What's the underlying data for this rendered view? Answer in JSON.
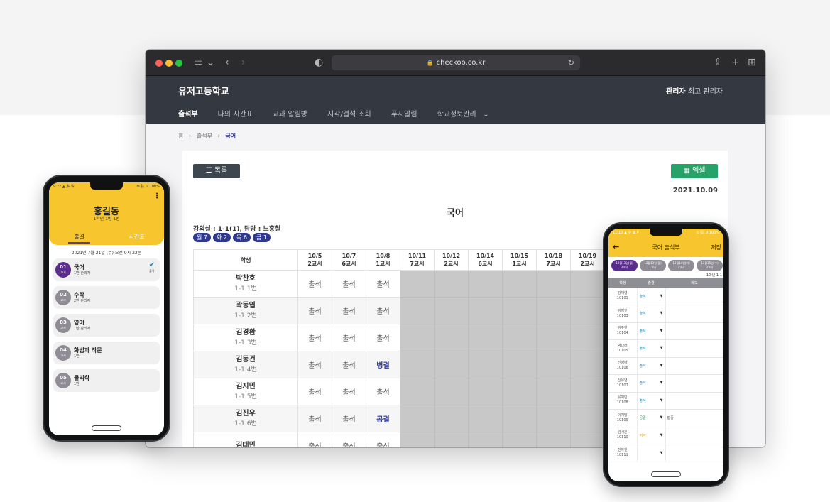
{
  "browser": {
    "url": "checkoo.co.kr"
  },
  "site": {
    "school_name": "유저고등학교",
    "admin_role": "관리자",
    "admin_name": "최고 관리자",
    "nav": [
      "출석부",
      "나의 시간표",
      "교과 알림방",
      "지각/결석 조회",
      "푸시알림",
      "학교정보관리"
    ]
  },
  "breadcrumb": [
    "홈",
    "출석부",
    "국어"
  ],
  "attendance": {
    "list_button": "목록",
    "excel_button": "엑셀",
    "date": "2021.10.09",
    "subject_title": "국어",
    "room_info": "강의실 : 1-1(1), 담당 : 노홍철",
    "day_chips": [
      "월 7",
      "화 2",
      "목 6",
      "금 1"
    ],
    "student_header": "학생",
    "columns": [
      {
        "date": "10/5",
        "period": "2교시"
      },
      {
        "date": "10/7",
        "period": "6교시"
      },
      {
        "date": "10/8",
        "period": "1교시"
      },
      {
        "date": "10/11",
        "period": "7교시"
      },
      {
        "date": "10/12",
        "period": "2교시"
      },
      {
        "date": "10/14",
        "period": "6교시"
      },
      {
        "date": "10/15",
        "period": "1교시"
      },
      {
        "date": "10/18",
        "period": "7교시"
      },
      {
        "date": "10/19",
        "period": "2교시"
      }
    ],
    "rows": [
      {
        "name": "박찬호",
        "number": "1-1 1번",
        "values": [
          "출석",
          "출석",
          "출석"
        ]
      },
      {
        "name": "곽동엽",
        "number": "1-1 2번",
        "values": [
          "출석",
          "출석",
          "출석"
        ]
      },
      {
        "name": "김경환",
        "number": "1-1 3번",
        "values": [
          "출석",
          "출석",
          "출석"
        ]
      },
      {
        "name": "김동건",
        "number": "1-1 4번",
        "values": [
          "출석",
          "출석",
          "병결"
        ]
      },
      {
        "name": "김지민",
        "number": "1-1 5번",
        "values": [
          "출석",
          "출석",
          "출석"
        ]
      },
      {
        "name": "김진우",
        "number": "1-1 6번",
        "values": [
          "출석",
          "출석",
          "공결"
        ]
      },
      {
        "name": "김태민",
        "number": "",
        "values": [
          "출석",
          "출석",
          "출석"
        ]
      }
    ]
  },
  "phone_left": {
    "status_left": "9:22 ▲ 多 令",
    "status_right": "⊠ 弘 .ıl 100%",
    "student_name": "홍길동",
    "class_info": "1학년 1반 1번",
    "tabs": [
      "출결",
      "시간표"
    ],
    "date_line": "2021년 7월 21일 (수) 오전 9시 22분",
    "classes": [
      {
        "num": "01",
        "unit": "교시",
        "subject": "국어",
        "sub": "1반 관리자",
        "check": "✔",
        "check_label": "출석"
      },
      {
        "num": "02",
        "unit": "교시",
        "subject": "수학",
        "sub": "2반 관리자"
      },
      {
        "num": "03",
        "unit": "교시",
        "subject": "영어",
        "sub": "1반 관리자"
      },
      {
        "num": "04",
        "unit": "교시",
        "subject": "화법과 작문",
        "sub": "1반"
      },
      {
        "num": "05",
        "unit": "교시",
        "subject": "물리학",
        "sub": "1반"
      }
    ]
  },
  "phone_right": {
    "status_left": "11:12 ▲ 令 ⊠ P",
    "status_right": "⊙ 弘 .ıl 100%",
    "title": "국어 출석부",
    "save": "저장",
    "date_chips": [
      {
        "line1": "12월13일(월)",
        "line2": "3교시"
      },
      {
        "line1": "12월13일(월)",
        "line2": "1교시"
      },
      {
        "line1": "12월14일(화)",
        "line2": "7교시"
      },
      {
        "line1": "12월15일(수)",
        "line2": "3교시"
      }
    ],
    "class_no": "1학년 1-1",
    "headers": [
      "학생",
      "출결",
      "메모"
    ],
    "students": [
      {
        "name": "강채영",
        "id": "10101",
        "status": "출석",
        "memo": ""
      },
      {
        "name": "김정인",
        "id": "10103",
        "status": "출석",
        "memo": ""
      },
      {
        "name": "김주현",
        "id": "10104",
        "status": "출석",
        "memo": ""
      },
      {
        "name": "박다래",
        "id": "10105",
        "status": "출석",
        "memo": ""
      },
      {
        "name": "신영애",
        "id": "10106",
        "status": "출석",
        "memo": ""
      },
      {
        "name": "신유연",
        "id": "10107",
        "status": "출석",
        "memo": ""
      },
      {
        "name": "유예빈",
        "id": "10108",
        "status": "출석",
        "memo": ""
      },
      {
        "name": "이예담",
        "id": "10109",
        "status": "공결",
        "memo": "접종"
      },
      {
        "name": "임시은",
        "id": "10110",
        "status": "지각",
        "memo": ""
      },
      {
        "name": "전아현",
        "id": "10111",
        "status": "",
        "memo": ""
      }
    ]
  },
  "colors": {
    "header_bg": "#343841",
    "accent_navy": "#2f3a8f",
    "excel_green": "#27a36a",
    "app_yellow": "#f7c62f",
    "app_purple": "#5b2d8c"
  }
}
